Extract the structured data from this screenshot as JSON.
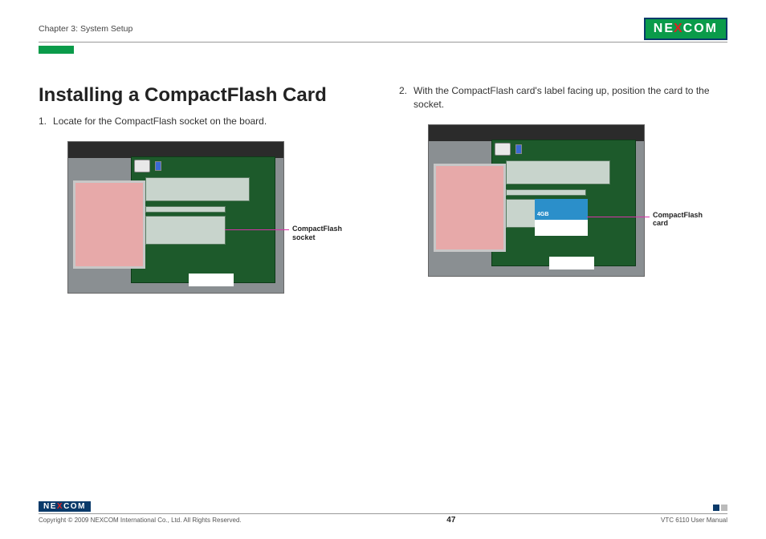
{
  "header": {
    "chapter": "Chapter 3: System Setup",
    "logo_text_left": "NE",
    "logo_text_x": "X",
    "logo_text_right": "COM"
  },
  "main": {
    "title": "Installing a CompactFlash Card",
    "step1_num": "1.",
    "step1_text": "Locate for the CompactFlash socket on the board.",
    "step2_num": "2.",
    "step2_text": "With the CompactFlash card's label facing up, position the card to the socket.",
    "callout1_line1": "CompactFlash",
    "callout1_line2": "socket",
    "callout2_line1": "CompactFlash",
    "callout2_line2": "card",
    "cf_capacity": "4GB"
  },
  "footer": {
    "logo_left": "NE",
    "logo_x": "X",
    "logo_right": "COM",
    "copyright": "Copyright © 2009 NEXCOM International Co., Ltd. All Rights Reserved.",
    "page": "47",
    "manual": "VTC 6110 User Manual"
  }
}
